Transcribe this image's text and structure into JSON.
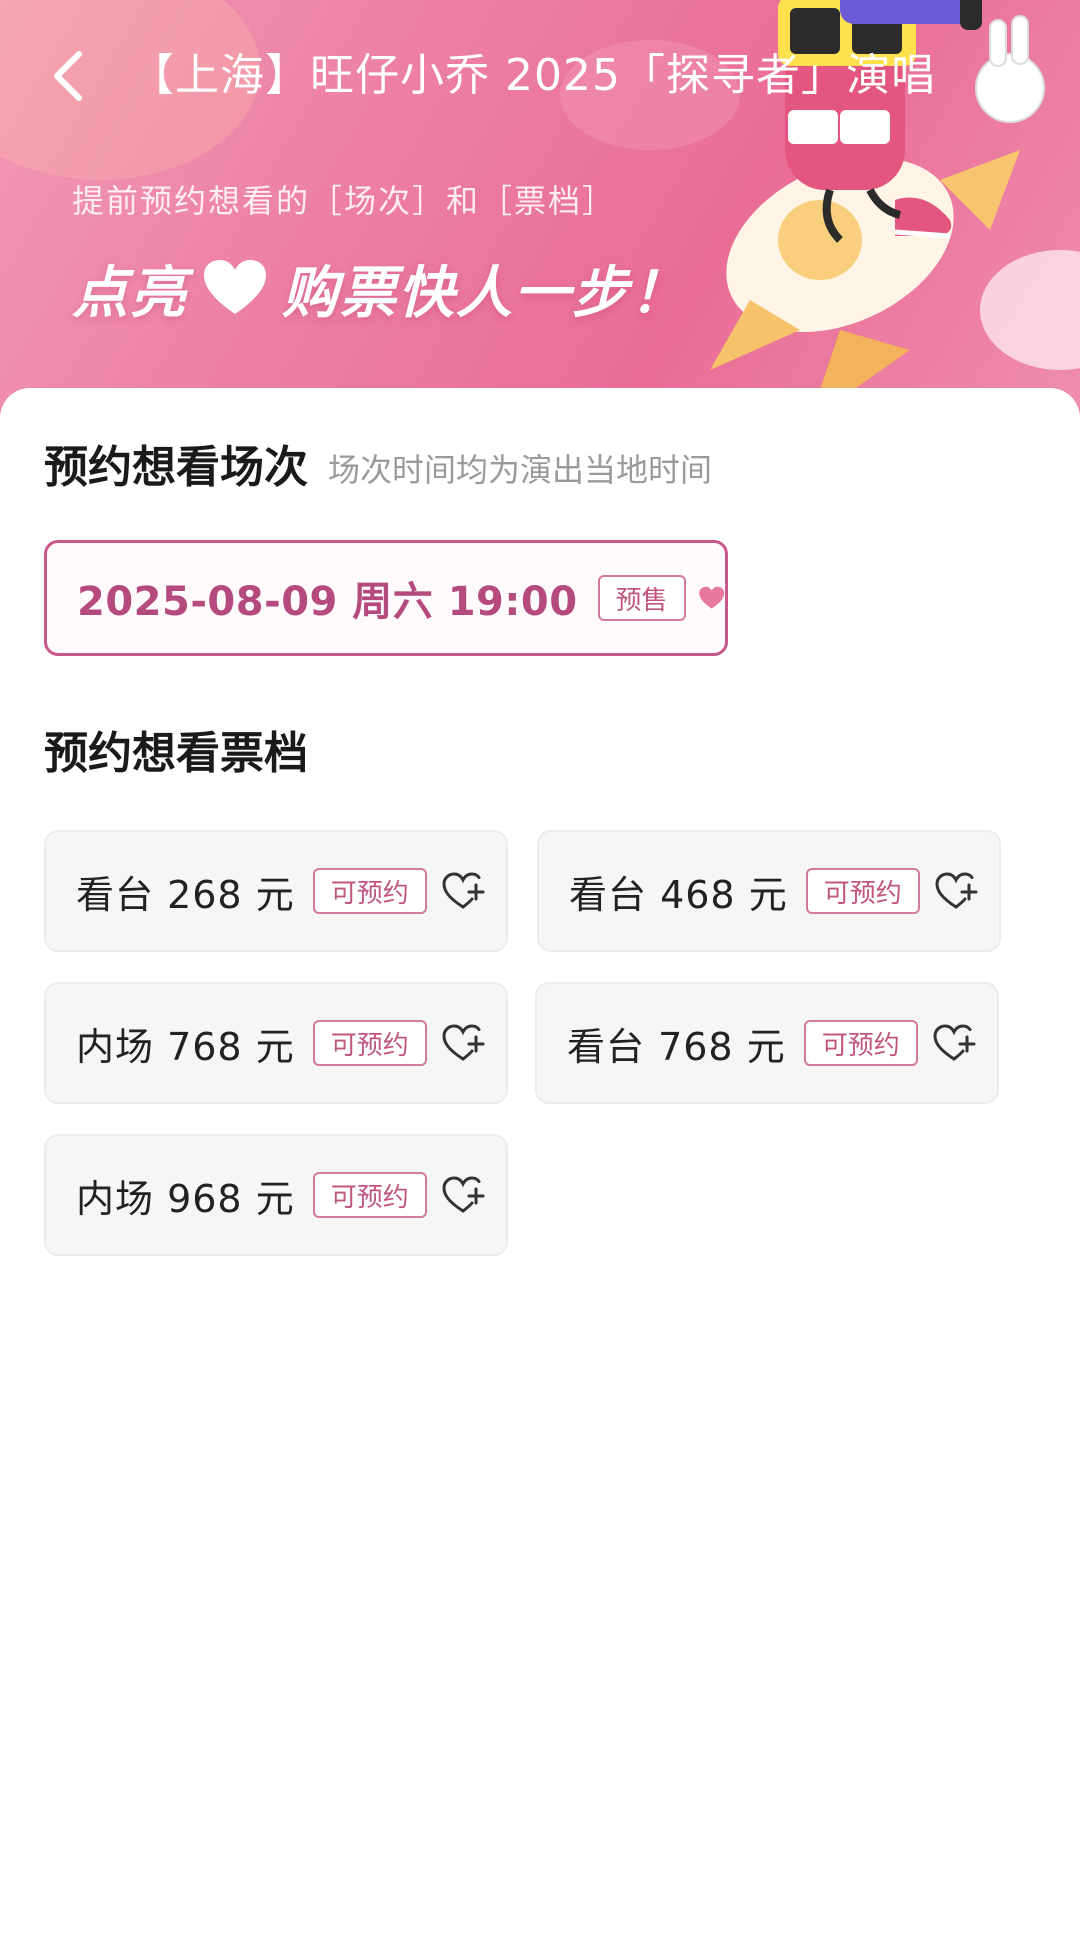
{
  "header": {
    "title": "【上海】旺仔小乔 2025「探寻者」演唱",
    "subtitle": "提前预约想看的［场次］和［票档］",
    "slogan_left": "点亮",
    "slogan_right": "购票快人一步！",
    "back_icon": "chevron-left-icon",
    "colors": {
      "banner_start": "#f29ab7",
      "banner_end": "#e96d96"
    }
  },
  "sessions": {
    "title": "预约想看场次",
    "hint": "场次时间均为演出当地时间",
    "items": [
      {
        "date_time": "2025-08-09  周六 19:00",
        "tag": "预售",
        "selected": true
      }
    ]
  },
  "tiers": {
    "title": "预约想看票档",
    "items": [
      {
        "label": "看台 268 元",
        "tag": "可预约"
      },
      {
        "label": "看台 468 元",
        "tag": "可预约"
      },
      {
        "label": "内场 768 元",
        "tag": "可预约"
      },
      {
        "label": "看台 768 元",
        "tag": "可预约"
      },
      {
        "label": "内场 968 元",
        "tag": "可预约"
      }
    ]
  },
  "theme": {
    "accent": "#c9588a",
    "accent_text": "#b44a7d",
    "heart_filled": "#e9789f",
    "tag_border": "#d17a9f"
  }
}
